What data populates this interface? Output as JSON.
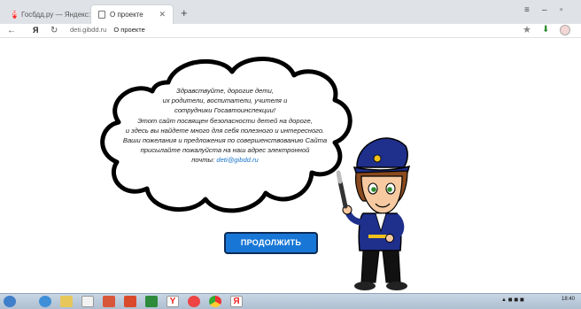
{
  "browser": {
    "tabs": [
      {
        "label": "Госбдд.ру — Яндекс: н",
        "active": false
      },
      {
        "label": "О проекте",
        "active": true
      }
    ],
    "new_tab_symbol": "+",
    "url": "deti.gibdd.ru",
    "page_title": "О проекте",
    "nav_icons": [
      "back-arrow-icon",
      "yandex-logo-icon",
      "reload-icon"
    ],
    "colors": {
      "tabbar": "#dfe3e8",
      "active_tab": "#ffffff"
    }
  },
  "page": {
    "greeting_lines": [
      "Здравствуйте, дорогие дети,",
      "их родители, воспитатели, учителя и",
      "сотрудники Госавтоинспекции!",
      "Этот сайт посвящен безопасности детей на дороге,",
      "и здесь вы найдете много для себя полезного  и интересного.",
      "Ваши пожелания и предложения  по совершенствованию Сайта",
      "присылайте пожалуйста на наш адрес электронной"
    ],
    "email_prefix": "почты: ",
    "email": "deti@gibdd.ru",
    "continue_button": "ПРОДОЛЖИТЬ",
    "colors": {
      "button": "#1877d6",
      "button_border": "#0d2b55",
      "email": "#1a73c8"
    }
  },
  "taskbar": {
    "time": "18:40"
  }
}
